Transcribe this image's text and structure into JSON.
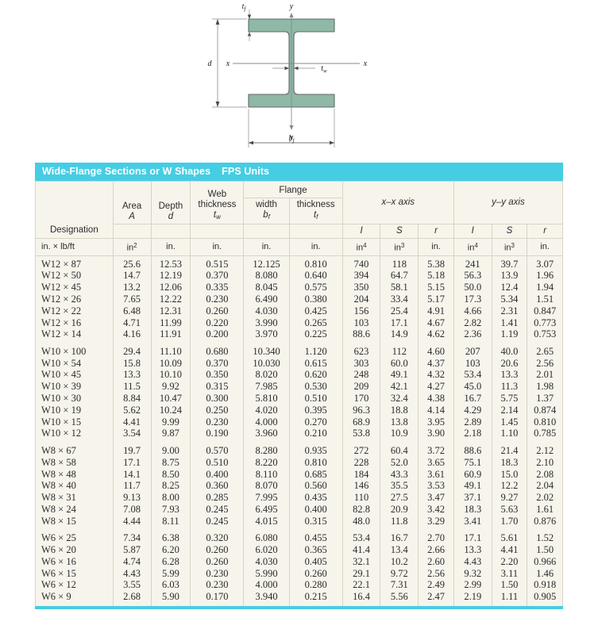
{
  "diagram": {
    "name": "wide-flange-beam-cross-section",
    "beam_fill": "#8fb8a6",
    "beam_stroke": "#5f6b68",
    "labels": {
      "flange_thickness": "t",
      "flange_thickness_sub": "f",
      "web_thickness": "t",
      "web_thickness_sub": "w",
      "depth": "d",
      "flange_width": "b",
      "flange_width_sub": "f",
      "axis_y_top": "y",
      "axis_y_bottom": "y",
      "axis_x_left": "x",
      "axis_x_right": "x"
    }
  },
  "table": {
    "title_main": "Wide-Flange Sections or W Shapes",
    "title_units": "FPS Units",
    "header": {
      "designation": "Designation",
      "area": "Area",
      "area_sym": "A",
      "depth": "Depth",
      "depth_sym": "d",
      "web": "Web",
      "web_thickness": "thickness",
      "web_sym": "t",
      "web_sym_sub": "w",
      "flange": "Flange",
      "flange_width": "width",
      "flange_width_sym": "b",
      "flange_width_sym_sub": "f",
      "flange_thickness": "thickness",
      "flange_thickness_sym": "t",
      "flange_thickness_sym_sub": "f",
      "x_axis": "x–x axis",
      "y_axis": "y–y axis",
      "I": "I",
      "S": "S",
      "r": "r"
    },
    "units": {
      "designation": "in. × lb/ft",
      "area": "in",
      "area_sup": "2",
      "depth": "in.",
      "web_thickness": "in.",
      "flange_width": "in.",
      "flange_thickness": "in.",
      "x_I": "in",
      "x_I_sup": "4",
      "x_S": "in",
      "x_S_sup": "3",
      "x_r": "in.",
      "y_I": "in",
      "y_I_sup": "4",
      "y_S": "in",
      "y_S_sup": "3",
      "y_r": "in."
    },
    "groups": [
      {
        "name": "W12",
        "rows": [
          [
            "W12 × 87",
            "25.6",
            "12.53",
            "0.515",
            "12.125",
            "0.810",
            "740",
            "118",
            "5.38",
            "241",
            "39.7",
            "3.07"
          ],
          [
            "W12 × 50",
            "14.7",
            "12.19",
            "0.370",
            "8.080",
            "0.640",
            "394",
            "64.7",
            "5.18",
            "56.3",
            "13.9",
            "1.96"
          ],
          [
            "W12 × 45",
            "13.2",
            "12.06",
            "0.335",
            "8.045",
            "0.575",
            "350",
            "58.1",
            "5.15",
            "50.0",
            "12.4",
            "1.94"
          ],
          [
            "W12 × 26",
            "7.65",
            "12.22",
            "0.230",
            "6.490",
            "0.380",
            "204",
            "33.4",
            "5.17",
            "17.3",
            "5.34",
            "1.51"
          ],
          [
            "W12 × 22",
            "6.48",
            "12.31",
            "0.260",
            "4.030",
            "0.425",
            "156",
            "25.4",
            "4.91",
            "4.66",
            "2.31",
            "0.847"
          ],
          [
            "W12 × 16",
            "4.71",
            "11.99",
            "0.220",
            "3.990",
            "0.265",
            "103",
            "17.1",
            "4.67",
            "2.82",
            "1.41",
            "0.773"
          ],
          [
            "W12 × 14",
            "4.16",
            "11.91",
            "0.200",
            "3.970",
            "0.225",
            "88.6",
            "14.9",
            "4.62",
            "2.36",
            "1.19",
            "0.753"
          ]
        ]
      },
      {
        "name": "W10",
        "rows": [
          [
            "W10 × 100",
            "29.4",
            "11.10",
            "0.680",
            "10.340",
            "1.120",
            "623",
            "112",
            "4.60",
            "207",
            "40.0",
            "2.65"
          ],
          [
            "W10 × 54",
            "15.8",
            "10.09",
            "0.370",
            "10.030",
            "0.615",
            "303",
            "60.0",
            "4.37",
            "103",
            "20.6",
            "2.56"
          ],
          [
            "W10 × 45",
            "13.3",
            "10.10",
            "0.350",
            "8.020",
            "0.620",
            "248",
            "49.1",
            "4.32",
            "53.4",
            "13.3",
            "2.01"
          ],
          [
            "W10 × 39",
            "11.5",
            "9.92",
            "0.315",
            "7.985",
            "0.530",
            "209",
            "42.1",
            "4.27",
            "45.0",
            "11.3",
            "1.98"
          ],
          [
            "W10 × 30",
            "8.84",
            "10.47",
            "0.300",
            "5.810",
            "0.510",
            "170",
            "32.4",
            "4.38",
            "16.7",
            "5.75",
            "1.37"
          ],
          [
            "W10 × 19",
            "5.62",
            "10.24",
            "0.250",
            "4.020",
            "0.395",
            "96.3",
            "18.8",
            "4.14",
            "4.29",
            "2.14",
            "0.874"
          ],
          [
            "W10 × 15",
            "4.41",
            "9.99",
            "0.230",
            "4.000",
            "0.270",
            "68.9",
            "13.8",
            "3.95",
            "2.89",
            "1.45",
            "0.810"
          ],
          [
            "W10 × 12",
            "3.54",
            "9.87",
            "0.190",
            "3.960",
            "0.210",
            "53.8",
            "10.9",
            "3.90",
            "2.18",
            "1.10",
            "0.785"
          ]
        ]
      },
      {
        "name": "W8",
        "rows": [
          [
            "W8 × 67",
            "19.7",
            "9.00",
            "0.570",
            "8.280",
            "0.935",
            "272",
            "60.4",
            "3.72",
            "88.6",
            "21.4",
            "2.12"
          ],
          [
            "W8 × 58",
            "17.1",
            "8.75",
            "0.510",
            "8.220",
            "0.810",
            "228",
            "52.0",
            "3.65",
            "75.1",
            "18.3",
            "2.10"
          ],
          [
            "W8 × 48",
            "14.1",
            "8.50",
            "0.400",
            "8.110",
            "0.685",
            "184",
            "43.3",
            "3.61",
            "60.9",
            "15.0",
            "2.08"
          ],
          [
            "W8 × 40",
            "11.7",
            "8.25",
            "0.360",
            "8.070",
            "0.560",
            "146",
            "35.5",
            "3.53",
            "49.1",
            "12.2",
            "2.04"
          ],
          [
            "W8 × 31",
            "9.13",
            "8.00",
            "0.285",
            "7.995",
            "0.435",
            "110",
            "27.5",
            "3.47",
            "37.1",
            "9.27",
            "2.02"
          ],
          [
            "W8 × 24",
            "7.08",
            "7.93",
            "0.245",
            "6.495",
            "0.400",
            "82.8",
            "20.9",
            "3.42",
            "18.3",
            "5.63",
            "1.61"
          ],
          [
            "W8 × 15",
            "4.44",
            "8.11",
            "0.245",
            "4.015",
            "0.315",
            "48.0",
            "11.8",
            "3.29",
            "3.41",
            "1.70",
            "0.876"
          ]
        ]
      },
      {
        "name": "W6",
        "rows": [
          [
            "W6 × 25",
            "7.34",
            "6.38",
            "0.320",
            "6.080",
            "0.455",
            "53.4",
            "16.7",
            "2.70",
            "17.1",
            "5.61",
            "1.52"
          ],
          [
            "W6 × 20",
            "5.87",
            "6.20",
            "0.260",
            "6.020",
            "0.365",
            "41.4",
            "13.4",
            "2.66",
            "13.3",
            "4.41",
            "1.50"
          ],
          [
            "W6 × 16",
            "4.74",
            "6.28",
            "0.260",
            "4.030",
            "0.405",
            "32.1",
            "10.2",
            "2.60",
            "4.43",
            "2.20",
            "0.966"
          ],
          [
            "W6 × 15",
            "4.43",
            "5.99",
            "0.230",
            "5.990",
            "0.260",
            "29.1",
            "9.72",
            "2.56",
            "9.32",
            "3.11",
            "1.46"
          ],
          [
            "W6 × 12",
            "3.55",
            "6.03",
            "0.230",
            "4.000",
            "0.280",
            "22.1",
            "7.31",
            "2.49",
            "2.99",
            "1.50",
            "0.918"
          ],
          [
            "W6 × 9",
            "2.68",
            "5.90",
            "0.170",
            "3.940",
            "0.215",
            "16.4",
            "5.56",
            "2.47",
            "2.19",
            "1.11",
            "0.905"
          ]
        ]
      }
    ]
  },
  "colors": {
    "accent": "#45cde4",
    "table_bg": "#f7f4ec",
    "grid": "#d8d3c6",
    "beam": "#8fb8a6"
  }
}
